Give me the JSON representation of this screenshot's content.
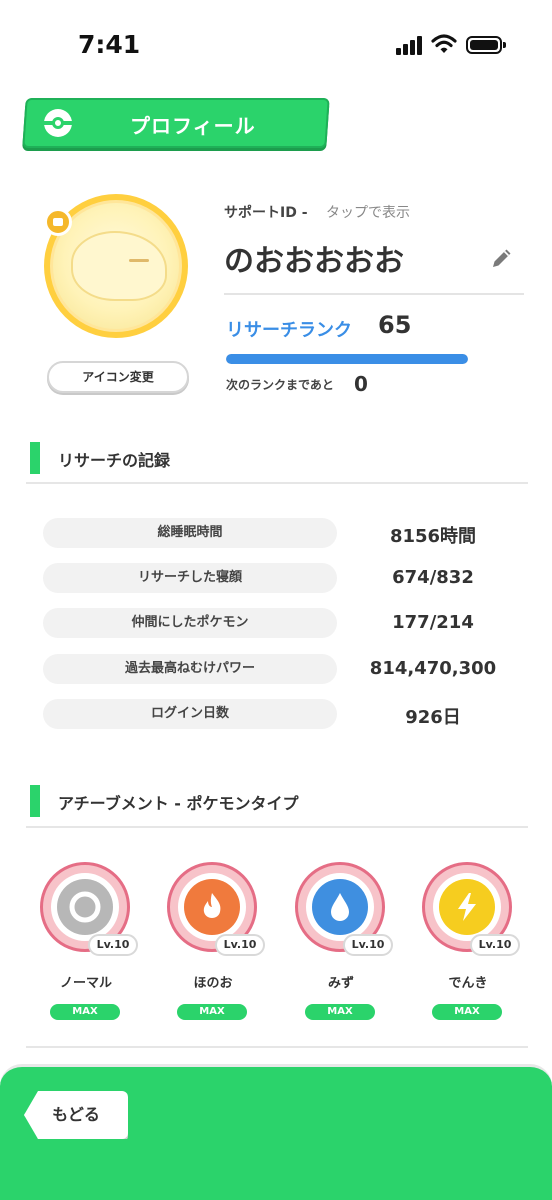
{
  "status_bar": {
    "time": "7:41"
  },
  "header": {
    "title": "プロフィール"
  },
  "profile": {
    "support_id_label": "サポートID -",
    "support_id_value": "タップで表示",
    "username": "のおおおおお",
    "icon_change_label": "アイコン変更",
    "rank_label": "リサーチランク",
    "rank_value": "65",
    "rank_progress": 1.0,
    "next_rank_label": "次のランクまであと",
    "next_rank_value": "0"
  },
  "records": {
    "title": "リサーチの記録",
    "rows": [
      {
        "label": "総睡眠時間",
        "value": "8156時間"
      },
      {
        "label": "リサーチした寝顔",
        "value": "674/832"
      },
      {
        "label": "仲間にしたポケモン",
        "value": "177/214"
      },
      {
        "label": "過去最高ねむけパワー",
        "value": "814,470,300"
      },
      {
        "label": "ログイン日数",
        "value": "926日"
      }
    ]
  },
  "achievements": {
    "title": "アチーブメント - ポケモンタイプ",
    "items": [
      {
        "name": "ノーマル",
        "level": "Lv.10",
        "status": "MAX",
        "icon": "normal-type-icon",
        "color": "#b7b7b7"
      },
      {
        "name": "ほのお",
        "level": "Lv.10",
        "status": "MAX",
        "icon": "fire-type-icon",
        "color": "#f07a3d"
      },
      {
        "name": "みず",
        "level": "Lv.10",
        "status": "MAX",
        "icon": "water-type-icon",
        "color": "#3f8fe0"
      },
      {
        "name": "でんき",
        "level": "Lv.10",
        "status": "MAX",
        "icon": "electric-type-icon",
        "color": "#f6cd1f"
      }
    ]
  },
  "footer": {
    "back_label": "もどる"
  },
  "colors": {
    "accent_green": "#2bd36b",
    "rank_blue": "#3a8ee6"
  }
}
